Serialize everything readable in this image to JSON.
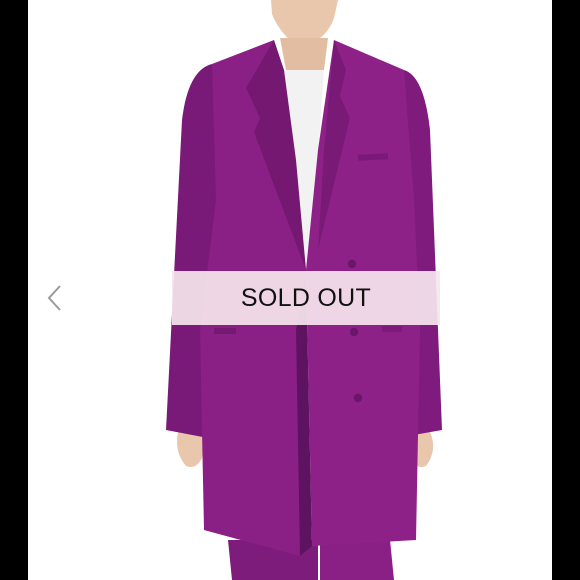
{
  "listing": {
    "sold_label": "SOLD OUT",
    "nav": {
      "prev_icon": "chevron-left-icon"
    },
    "colors": {
      "coat": "#8a1f86",
      "coat_shadow": "#6e1770",
      "banner": "#f6e6ee",
      "background": "#ffffff",
      "frame": "#000000"
    }
  }
}
